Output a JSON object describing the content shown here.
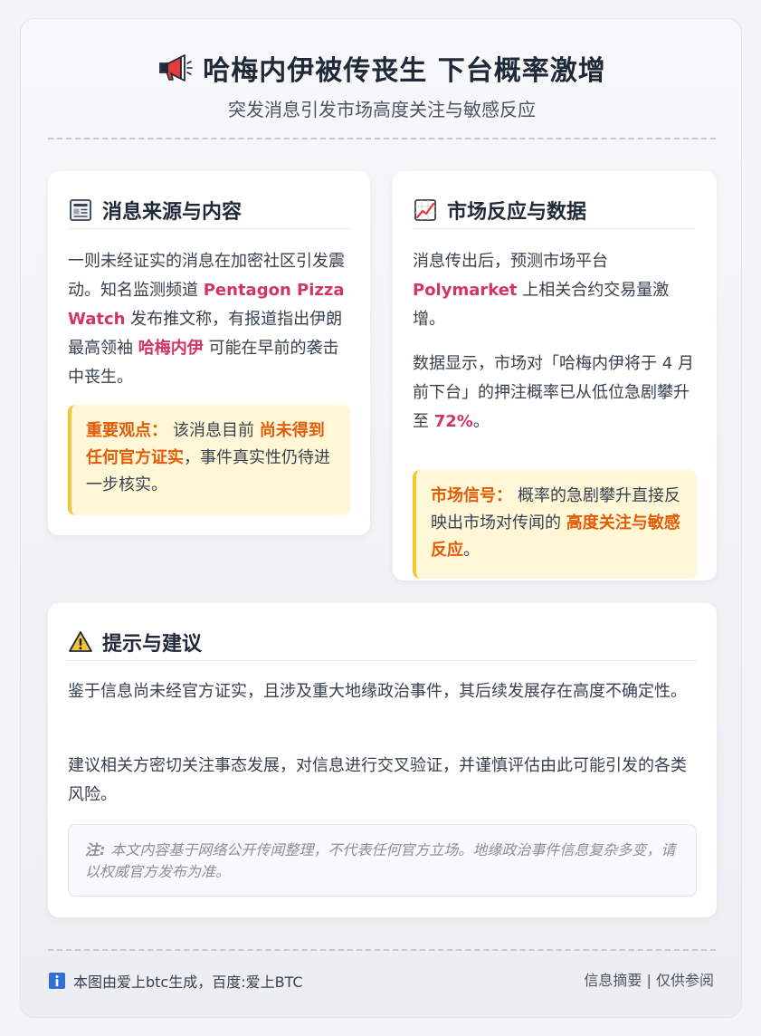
{
  "header": {
    "icon": "megaphone-icon",
    "title": "哈梅内伊被传丧生 下台概率激增",
    "subtitle": "突发消息引发市场高度关注与敏感反应"
  },
  "source_card": {
    "icon": "newspaper-icon",
    "heading": "消息来源与内容",
    "para": {
      "t1": "一则未经证实的消息在加密社区引发震动。知名监测频道 ",
      "h1": "Pentagon Pizza Watch",
      "t2": " 发布推文称，有报道指出伊朗最高领袖 ",
      "h2": "哈梅内伊",
      "t3": " 可能在早前的袭击中丧生。"
    },
    "callout": {
      "lead": "重要观点：",
      "t1": "该消息目前 ",
      "h1": "尚未得到任何官方证实",
      "t2": "，事件真实性仍待进一步核实。"
    }
  },
  "market_card": {
    "icon": "chart-up-icon",
    "heading": "市场反应与数据",
    "para1": {
      "t1": "消息传出后，预测市场平台 ",
      "h1": "Polymarket",
      "t2": " 上相关合约交易量激增。"
    },
    "para2": {
      "t1": "数据显示，市场对「哈梅内伊将于 4 月前下台」的押注概率已从低位急剧攀升至 ",
      "h1": "72%",
      "t2": "。"
    },
    "callout": {
      "lead": "市场信号：",
      "t1": "概率的急剧攀升直接反映出市场对传闻的 ",
      "h1": "高度关注与敏感反应",
      "t2": "。"
    }
  },
  "advice_card": {
    "icon": "warning-icon",
    "heading": "提示与建议",
    "para1": "鉴于信息尚未经官方证实，且涉及重大地缘政治事件，其后续发展存在高度不确定性。",
    "para2": "建议相关方密切关注事态发展，对信息进行交叉验证，并谨慎评估由此可能引发的各类风险。",
    "note": {
      "lead": "注:",
      "text": "本文内容基于网络公开传闻整理，不代表任何官方立场。地缘政治事件信息复杂多变，请以权威官方发布为准。"
    }
  },
  "footer": {
    "icon": "info-icon",
    "left": "本图由爱上btc生成，百度:爱上BTC",
    "right": "信息摘要 | 仅供参阅"
  },
  "colors": {
    "highlight_pink": "#d1336b",
    "highlight_orange": "#e25c0a",
    "callout_bg": "#fff7d6",
    "callout_border": "#f5c534"
  }
}
